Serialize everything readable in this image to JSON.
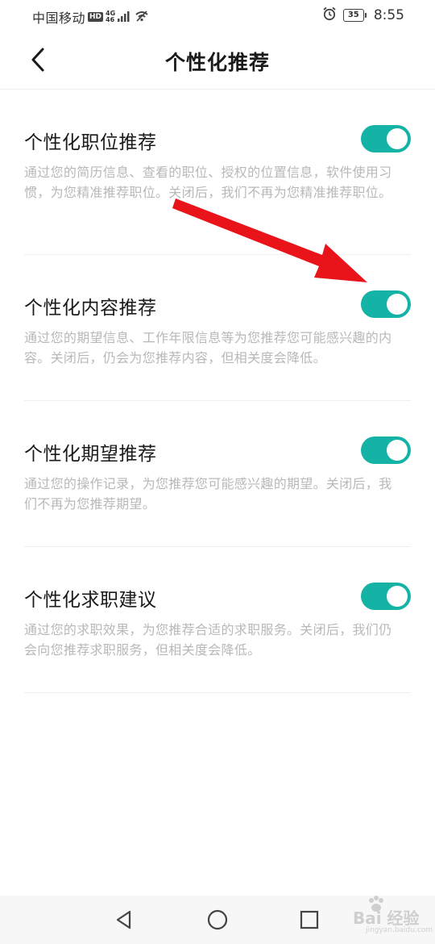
{
  "status_bar": {
    "carrier": "中国移动",
    "hd": "HD",
    "network_top": "4G",
    "network_bottom": "46",
    "battery": "35",
    "time": "8:55"
  },
  "header": {
    "title": "个性化推荐"
  },
  "settings": [
    {
      "title": "个性化职位推荐",
      "desc": "通过您的简历信息、查看的职位、授权的位置信息，软件使用习惯，为您精准推荐职位。关闭后，我们不再为您精准推荐职位。",
      "enabled": true
    },
    {
      "title": "个性化内容推荐",
      "desc": "通过您的期望信息、工作年限信息等为您推荐您可能感兴趣的内容。关闭后，仍会为您推荐内容，但相关度会降低。",
      "enabled": true
    },
    {
      "title": "个性化期望推荐",
      "desc": "通过您的操作记录，为您推荐您可能感兴趣的期望。关闭后，我们不再为您推荐期望。",
      "enabled": true
    },
    {
      "title": "个性化求职建议",
      "desc": "通过您的求职效果，为您推荐合适的求职服务。关闭后，我们仍会向您推荐求职服务，但相关度会降低。",
      "enabled": true
    }
  ],
  "colors": {
    "toggle_on": "#15b3a5",
    "arrow": "#e8141a",
    "desc_text": "#b8b8b8"
  },
  "icons": {
    "back": "chevron-left-icon",
    "nav_back": "triangle-back-icon",
    "nav_home": "circle-home-icon",
    "nav_recent": "square-recent-icon"
  },
  "watermark": {
    "brand": "Bai 经验",
    "sub": "jingyan.baidu.com"
  }
}
